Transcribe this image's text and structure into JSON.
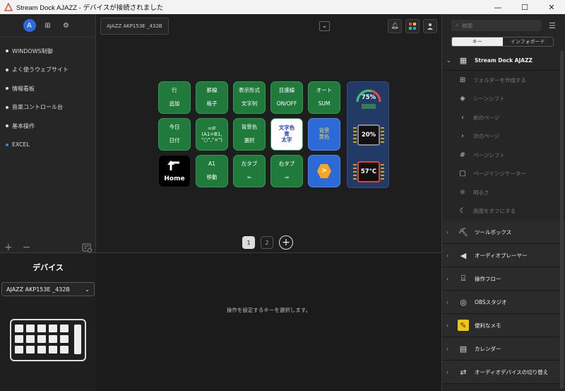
{
  "window": {
    "title": "Stream Dock AJAZZ - デバイスが接続されました",
    "minimize": "—",
    "maximize": "☐",
    "close": "✕"
  },
  "left": {
    "profiles": [
      {
        "label": "WINDOWS制御",
        "active": false
      },
      {
        "label": "よく使うウェブサイト",
        "active": false
      },
      {
        "label": "情報看板",
        "active": false
      },
      {
        "label": "音楽コントロール台",
        "active": false
      },
      {
        "label": "基本操作",
        "active": false
      },
      {
        "label": "EXCEL",
        "active": true
      }
    ],
    "add": "+",
    "remove": "−",
    "device_title": "デバイス",
    "device_selected": "AJAZZ AKP153E _432B"
  },
  "center": {
    "device_tab": "AJAZZ AKP153E _432B",
    "keys": [
      {
        "lines": [
          "行",
          "追加"
        ]
      },
      {
        "lines": [
          "罫線",
          "格子"
        ]
      },
      {
        "lines": [
          "表示形式",
          "文字列"
        ]
      },
      {
        "lines": [
          "目盛線",
          "ON/OFF"
        ]
      },
      {
        "lines": [
          "オート",
          "SUM"
        ]
      },
      {
        "lines": [
          "今日",
          "日付"
        ]
      },
      {
        "lines": [
          "=IF",
          "(A1=B1,",
          "\"○\",\"×\")"
        ]
      },
      {
        "lines": [
          "背景色",
          "選択"
        ]
      },
      {
        "lines": [
          "文字色",
          "青",
          "太字"
        ]
      },
      {
        "lines": [
          "背景",
          "黄色"
        ]
      },
      {
        "lines": [
          "Home"
        ]
      },
      {
        "lines": [
          "A1",
          "移動"
        ]
      },
      {
        "lines": [
          "左タブ",
          "⇐"
        ]
      },
      {
        "lines": [
          "右タブ",
          "⇒"
        ]
      },
      {
        "lines": [
          ">"
        ]
      }
    ],
    "monitors": [
      "75%",
      "20%",
      "57°C"
    ],
    "pages": [
      "1",
      "2"
    ],
    "add_page": "+",
    "hint": "操作を設定するキーを選択します。"
  },
  "right": {
    "search_placeholder": "検索",
    "tab_key": "キー",
    "tab_info": "インフォボード",
    "open_category": "Stream Dock AJAZZ",
    "sub_items": [
      {
        "label": "フォルダーを作成する",
        "icon": "folder-plus-icon"
      },
      {
        "label": "シーンシフト",
        "icon": "layers-icon"
      },
      {
        "label": "前のページ",
        "icon": "prev-page-icon"
      },
      {
        "label": "次のページ",
        "icon": "next-page-icon"
      },
      {
        "label": "ページシフト",
        "icon": "hash-icon"
      },
      {
        "label": "ページインジケーター",
        "icon": "square-icon"
      },
      {
        "label": "明るさ",
        "icon": "brightness-icon"
      },
      {
        "label": "画面をオフにする",
        "icon": "moon-icon"
      }
    ],
    "categories": [
      {
        "label": "ツールボックス",
        "icon": "toolbox-icon"
      },
      {
        "label": "オーディオプレーヤー",
        "icon": "speaker-icon"
      },
      {
        "label": "操作フロー",
        "icon": "flow-icon"
      },
      {
        "label": "OBSスタジオ",
        "icon": "obs-icon"
      },
      {
        "label": "便利なメモ",
        "icon": "memo-icon"
      },
      {
        "label": "カレンダー",
        "icon": "calendar-icon"
      },
      {
        "label": "オーディオデバイスの切り替え",
        "icon": "audio-switch-icon"
      }
    ]
  }
}
